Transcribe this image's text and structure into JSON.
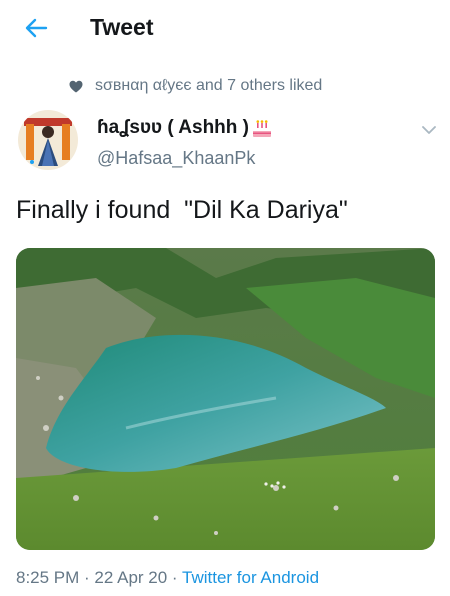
{
  "header": {
    "title": "Tweet",
    "back_icon": "arrow-left-icon"
  },
  "social_context": {
    "text": "sσвнαη αℓуєє and 7 others liked",
    "icon": "heart-icon"
  },
  "author": {
    "display_name": "ɦaʆsʋʋ ( Ashhh )",
    "emoji": "birthday-cake-icon",
    "handle": "@Hafsaa_KhaanPk"
  },
  "tweet": {
    "text": "Finally i found  \"Dil Ka Dariya\"",
    "media": "photo: heart-shaped turquoise lake in green mountain valley"
  },
  "meta": {
    "time": "8:25 PM",
    "date": "22 Apr 20",
    "separator": " · ",
    "source": "Twitter for Android"
  },
  "colors": {
    "accent": "#1da1f2",
    "secondary_text": "#657786",
    "primary_text": "#14171a"
  }
}
